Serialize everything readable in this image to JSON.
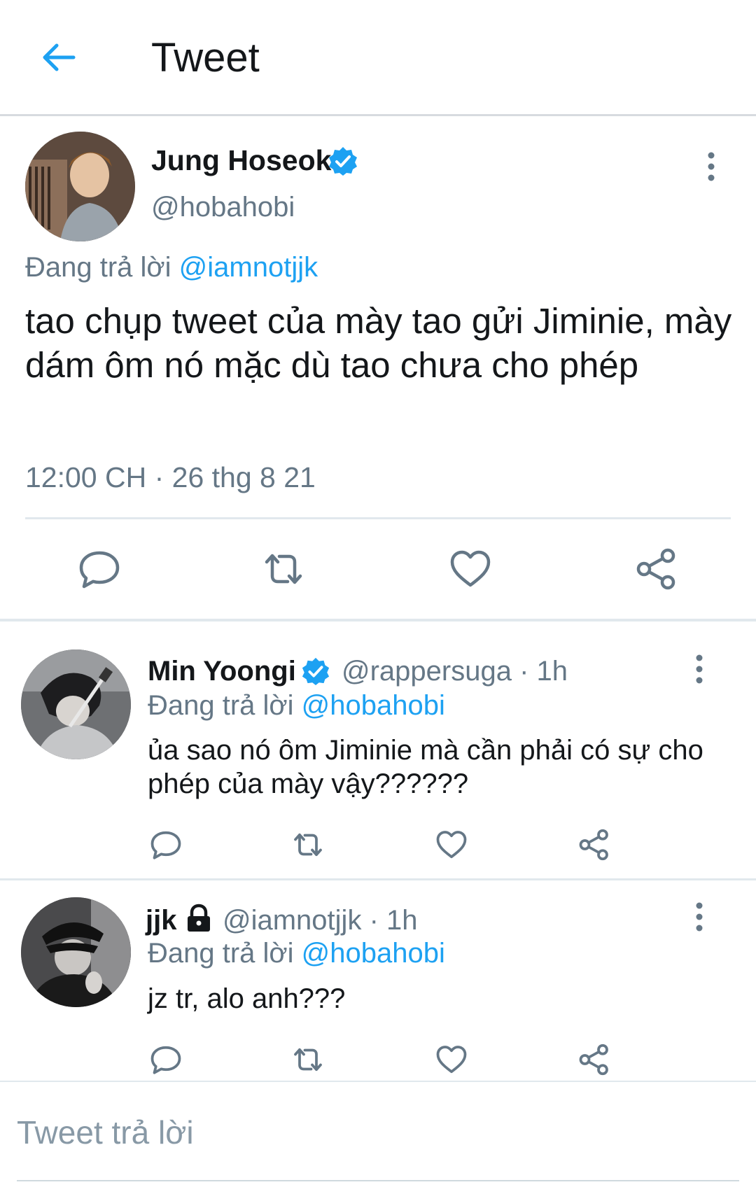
{
  "header": {
    "title": "Tweet"
  },
  "main_tweet": {
    "name": "Jung Hoseok",
    "handle": "@hobahobi",
    "reply_prefix": "Đang trả lời",
    "reply_to": "@iamnotjjk",
    "text": "tao chụp tweet của mày tao gửi Jiminie, mày dám ôm nó mặc dù tao chưa cho phép",
    "timestamp": "12:00 CH · 26 thg 8 21"
  },
  "replies": [
    {
      "name": "Min Yoongi",
      "handle": "@rappersuga",
      "time": "· 1h",
      "reply_prefix": "Đang trả lời",
      "reply_to": "@hobahobi",
      "text": "ủa sao nó ôm Jiminie mà cần phải có sự cho phép của mày vậy??????"
    },
    {
      "name": "jjk",
      "handle": "@iamnotjjk",
      "time": "· 1h",
      "reply_prefix": "Đang trả lời",
      "reply_to": "@hobahobi",
      "text": "jz tr, alo anh???"
    }
  ],
  "compose": {
    "placeholder": "Tweet trả lời"
  },
  "colors": {
    "accent": "#1da1f2",
    "text": "#14171a",
    "secondary": "#657786",
    "divider": "#e1e8ed"
  }
}
